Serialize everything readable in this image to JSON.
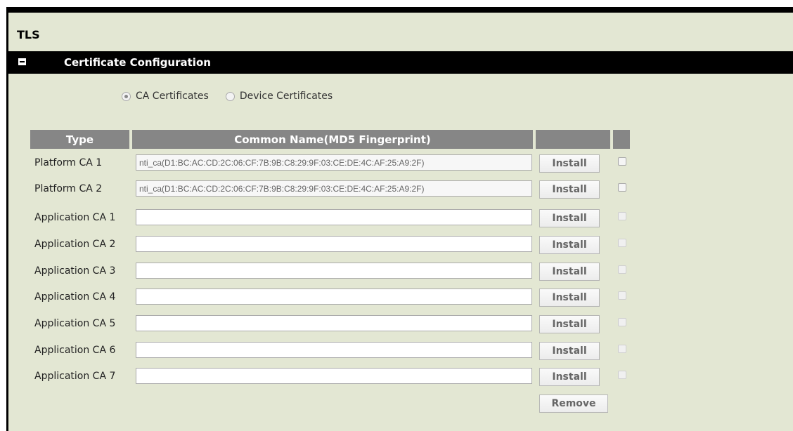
{
  "panel": {
    "title": "TLS"
  },
  "section": {
    "title": "Certificate Configuration"
  },
  "radios": [
    {
      "label": "CA Certificates",
      "checked": true
    },
    {
      "label": "Device Certificates",
      "checked": false
    }
  ],
  "table": {
    "headers": {
      "type": "Type",
      "common_name": "Common Name(MD5 Fingerprint)",
      "action": "",
      "select": ""
    },
    "rows": [
      {
        "label": "Platform CA 1",
        "value": "nti_ca(D1:BC:AC:CD:2C:06:CF:7B:9B:C8:29:9F:03:CE:DE:4C:AF:25:A9:2F)",
        "button": "Install"
      },
      {
        "label": "Platform CA 2",
        "value": "nti_ca(D1:BC:AC:CD:2C:06:CF:7B:9B:C8:29:9F:03:CE:DE:4C:AF:25:A9:2F)",
        "button": "Install"
      },
      {
        "label": "Application CA 1",
        "value": "",
        "button": "Install"
      },
      {
        "label": "Application CA 2",
        "value": "",
        "button": "Install"
      },
      {
        "label": "Application CA 3",
        "value": "",
        "button": "Install"
      },
      {
        "label": "Application CA 4",
        "value": "",
        "button": "Install"
      },
      {
        "label": "Application CA 5",
        "value": "",
        "button": "Install"
      },
      {
        "label": "Application CA 6",
        "value": "",
        "button": "Install"
      },
      {
        "label": "Application CA 7",
        "value": "",
        "button": "Install"
      }
    ]
  },
  "remove_button": "Remove"
}
